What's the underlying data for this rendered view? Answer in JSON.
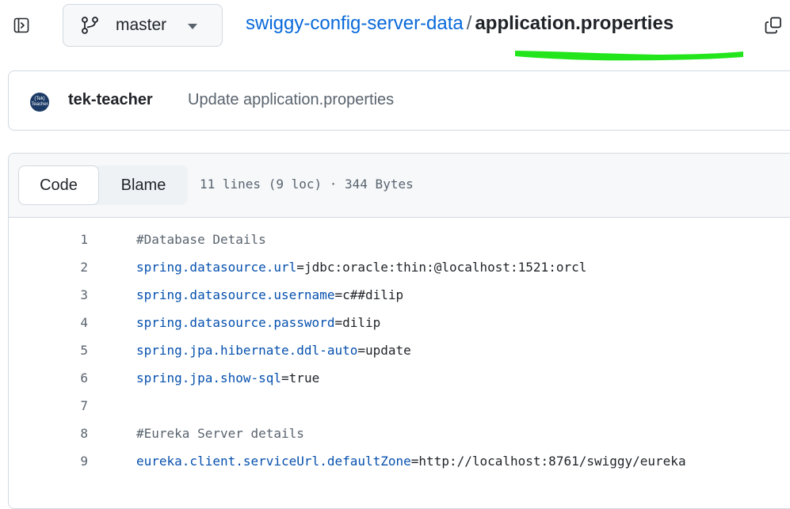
{
  "header": {
    "sidebar_toggle_icon": "sidebar-expand-icon",
    "branch": {
      "icon": "git-branch-icon",
      "label": "master"
    },
    "breadcrumb": {
      "repo": "swiggy-config-server-data",
      "separator": "/",
      "file": "application.properties"
    },
    "copy_icon": "copy-icon",
    "highlight_color": "#22e51c"
  },
  "commit": {
    "avatar_text": [
      "(Tek)",
      "Teacher"
    ],
    "author": "tek-teacher",
    "message": "Update application.properties"
  },
  "file": {
    "tabs": {
      "code": "Code",
      "blame": "Blame"
    },
    "meta": "11 lines (9 loc) · 344 Bytes",
    "lines": [
      {
        "num": "1",
        "comment": "#Database Details"
      },
      {
        "num": "2",
        "key": "spring.datasource.url",
        "op": "=",
        "value": "jdbc:oracle:thin:@localhost:1521:orcl"
      },
      {
        "num": "3",
        "key": "spring.datasource.username",
        "op": "=",
        "value": "c##dilip"
      },
      {
        "num": "4",
        "key": "spring.datasource.password",
        "op": "=",
        "value": "dilip"
      },
      {
        "num": "5",
        "key": "spring.jpa.hibernate.ddl-auto",
        "op": "=",
        "value": "update"
      },
      {
        "num": "6",
        "key": "spring.jpa.show-sql",
        "op": "=",
        "value": "true"
      },
      {
        "num": "7"
      },
      {
        "num": "8",
        "comment": "#Eureka Server details"
      },
      {
        "num": "9",
        "key": "eureka.client.serviceUrl.defaultZone",
        "op": "=",
        "value": "http://localhost:8761/swiggy/eureka"
      }
    ]
  },
  "colors": {
    "link": "#0969da",
    "key": "#0550ae",
    "muted": "#59636e",
    "border": "#d1d9e0",
    "header_bg": "#f6f8fa"
  }
}
